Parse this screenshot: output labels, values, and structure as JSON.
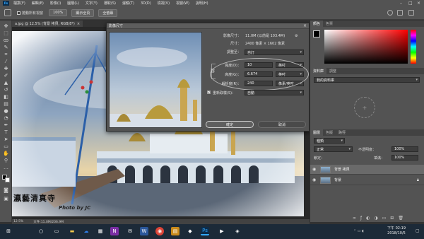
{
  "menubar": {
    "app_icon": "Ps",
    "items": [
      "檔案(F)",
      "編輯(E)",
      "影像(I)",
      "圖層(L)",
      "文字(Y)",
      "選取(S)",
      "濾鏡(T)",
      "3D(D)",
      "檢視(V)",
      "視窗(W)",
      "說明(H)"
    ]
  },
  "options_bar": {
    "checkbox_label": "捲動所有視窗",
    "zoom_button": "100%",
    "fit_screen_button": "顯示全頁",
    "fill_screen_button": "全螢幕"
  },
  "document": {
    "tab_title": "a.jpg @ 12.5% (背景 拷貝, RGB/8*)",
    "watermark_title": "瀛藝清真寺",
    "watermark_credit": "Photo by JC",
    "status_zoom": "12.5%",
    "status_doc": "文件:11.0M/206.9M"
  },
  "dialog": {
    "title": "影像尺寸",
    "image_size_label": "影像尺寸：",
    "image_size_value": "11.0M (以前是 103.4M)",
    "dimensions_label": "尺寸：",
    "dimensions_value": "2400 像素 × 1602 像素",
    "fit_label": "調整至：",
    "fit_value": "自訂",
    "width_label": "寬度(D)：",
    "width_value": "10",
    "width_unit": "英吋",
    "height_label": "高度(G)：",
    "height_value": "6.674",
    "height_unit": "英吋",
    "resolution_label": "解析度(R)：",
    "resolution_value": "240",
    "resolution_unit": "像素/英吋",
    "resample_label": "重新取樣(S)：",
    "resample_value": "自動",
    "ok_button": "確定",
    "cancel_button": "取消"
  },
  "panels": {
    "color_tabs": [
      "顏色",
      "色票"
    ],
    "library_tabs": [
      "資料庫",
      "調整"
    ],
    "library_dropdown": "我的資料庫",
    "layers_tabs": [
      "圖層",
      "色版",
      "路徑"
    ],
    "kind_label": "種類",
    "blend_mode": "正常",
    "opacity_label": "不透明度：",
    "opacity_value": "100%",
    "lock_label": "鎖定：",
    "fill_label": "填滿：",
    "fill_value": "100%",
    "layers": [
      {
        "name": "背景 拷貝"
      },
      {
        "name": "背景"
      }
    ]
  },
  "taskbar": {
    "time": "下午 02:19",
    "date": "2018/10/5"
  },
  "colors": {
    "ui_dark": "#323232",
    "panel": "#535353",
    "accent_blue": "#31a8ff",
    "taskbar": "#1c2a38"
  }
}
